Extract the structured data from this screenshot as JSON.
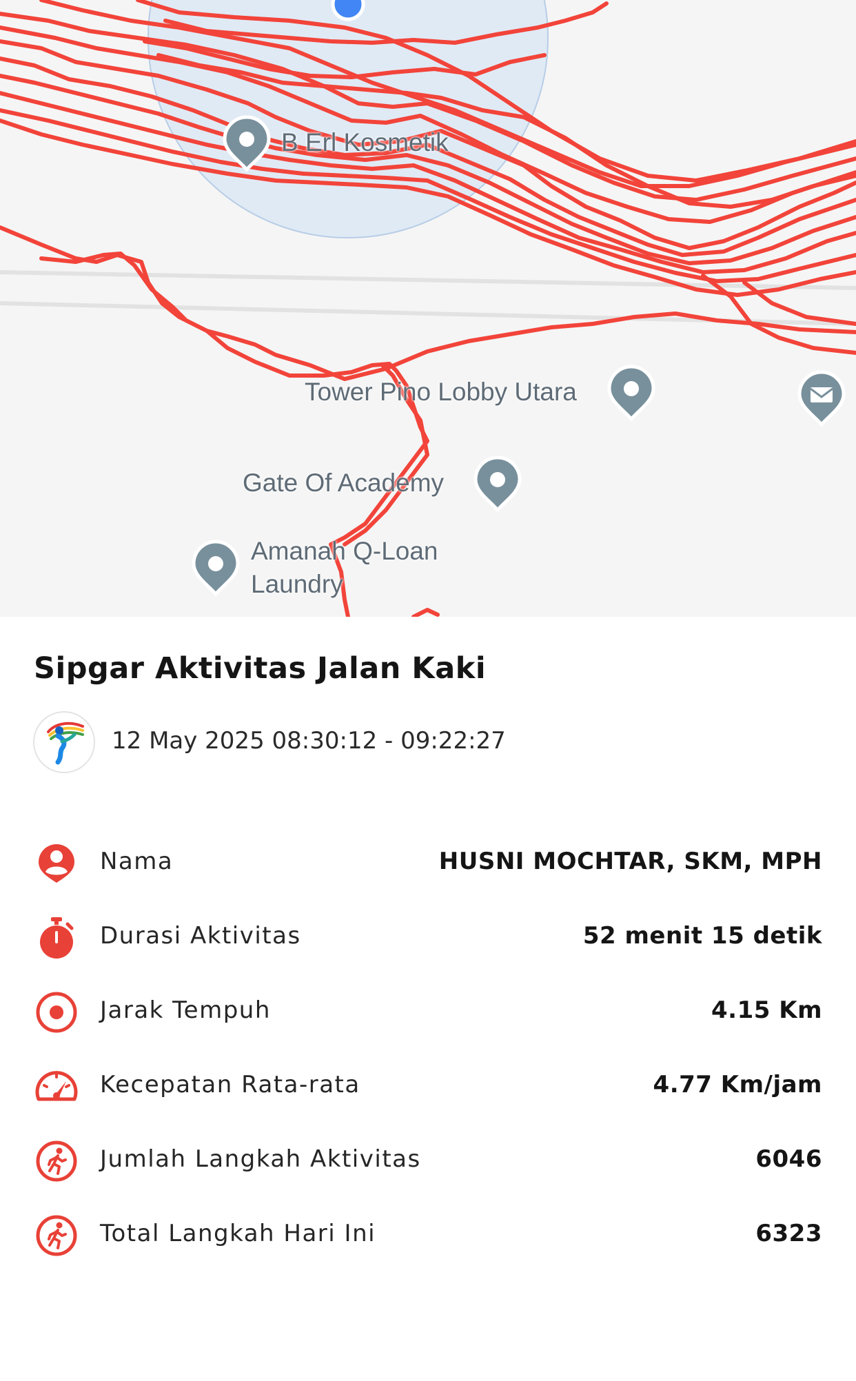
{
  "colors": {
    "route": "#f2443a",
    "accent": "#e84137",
    "map_background": "#f5f5f5",
    "poi_pin": "#78909c",
    "location_dot": "#4285f4"
  },
  "map": {
    "places": [
      {
        "name": "B Erl Kosmetik",
        "icon": "pin-icon"
      },
      {
        "name": "Tower Pino Lobby Utara",
        "icon": "pin-icon"
      },
      {
        "name": "Gate Of Academy",
        "icon": "pin-icon"
      },
      {
        "name": "Amanah Q-Loan",
        "name_line2": "Laundry",
        "icon": "pin-icon"
      },
      {
        "icon": "mail-icon"
      }
    ]
  },
  "activity": {
    "title": "Sipgar Aktivitas Jalan Kaki",
    "datetime": "12 May 2025 08:30:12 - 09:22:27",
    "logo_icon": "app-logo-icon",
    "stats": [
      {
        "icon": "person-icon",
        "label": "Nama",
        "value": "HUSNI MOCHTAR, SKM, MPH"
      },
      {
        "icon": "stopwatch-icon",
        "label": "Durasi Aktivitas",
        "value": "52 menit 15 detik"
      },
      {
        "icon": "target-icon",
        "label": "Jarak Tempuh",
        "value": "4.15 Km"
      },
      {
        "icon": "speedometer-icon",
        "label": "Kecepatan Rata-rata",
        "value": "4.77 Km/jam"
      },
      {
        "icon": "walking-icon",
        "label": "Jumlah Langkah Aktivitas",
        "value": "6046"
      },
      {
        "icon": "walking-icon",
        "label": "Total Langkah Hari Ini",
        "value": "6323"
      }
    ]
  }
}
